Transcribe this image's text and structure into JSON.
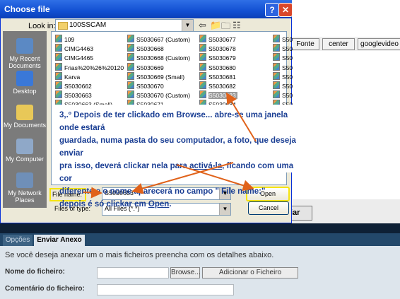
{
  "background": {
    "toolbar_buttons": [
      "Fonte",
      "center",
      "googlevideo"
    ],
    "submit_label": "iar",
    "tabs": [
      "Opções",
      "Enviar Anexo"
    ],
    "intro": "Se você deseja anexar um o mais ficheiros preencha com os detalhes abaixo.",
    "file_name_label": "Nome do ficheiro:",
    "browse_label": "Browse...",
    "add_file_label": "Adicionar o Ficheiro",
    "comment_label": "Comentário do ficheiro:"
  },
  "dialog": {
    "title": "Choose file",
    "help_glyph": "?",
    "close_glyph": "✕",
    "look_in_label": "Look in:",
    "look_in_value": "100SSCAM",
    "places": [
      "My Recent Documents",
      "Desktop",
      "My Documents",
      "My Computer",
      "My Network Places"
    ],
    "files_col1": [
      "109",
      "CIMG4463",
      "CIMG4465",
      "Frias%20%26%20120",
      "Karva",
      "S5030662",
      "S5030663",
      "S5030663 (Small)"
    ],
    "files_col2": [
      "S5030667 (Custom)",
      "S5030668",
      "S5030668 (Custom)",
      "S5030669",
      "S5030669 (Small)",
      "S5030670",
      "S5030670 (Custom)",
      "S5030671"
    ],
    "files_col3": [
      "S5030677",
      "S5030678",
      "S5030679",
      "S5030680",
      "S5030681",
      "S5030682",
      "S5030683",
      "S5030684"
    ],
    "files_col4": [
      "S50",
      "S50",
      "S50",
      "S50",
      "S50",
      "S50",
      "S50",
      "S50"
    ],
    "selected_file": "S5030683",
    "file_name_label": "File name:",
    "file_name_value": "S5030683",
    "files_of_type_label": "Files of type:",
    "files_of_type_value": "All Files (*.*)",
    "open_label": "Open",
    "cancel_label": "Cancel"
  },
  "annotation": {
    "line1": "3,.º Depois de ter clickado em Browse... abre-se uma janela onde estará",
    "line2": "guardada, numa pasta do seu computador, a foto, que deseja enviar",
    "line3a": "pra isso, deverá  clickar nela para ",
    "line3b": "activá-la,",
    "line3c": " ficando com uma cor",
    "line4": "diferente e o nome aparecerá no campo \" File name:\"",
    "line5a": "depois é só clickar em ",
    "line5b": "Open",
    "line5c": "."
  },
  "colors": {
    "annotation_text": "#1b3f94",
    "arrow": "#e0621a",
    "highlight": "#f5e411"
  }
}
